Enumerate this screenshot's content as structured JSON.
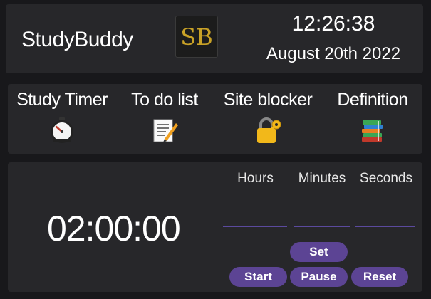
{
  "header": {
    "app_title": "StudyBuddy",
    "logo_text": "SB",
    "time": "12:26:38",
    "date": "August 20th 2022"
  },
  "nav": {
    "items": [
      {
        "label": "Study Timer",
        "icon": "stopwatch-icon"
      },
      {
        "label": "To do list",
        "icon": "memo-icon"
      },
      {
        "label": "Site blocker",
        "icon": "lock-with-key-icon"
      },
      {
        "label": "Definition",
        "icon": "books-icon"
      }
    ]
  },
  "timer": {
    "display": "02:00:00",
    "hours_label": "Hours",
    "minutes_label": "Minutes",
    "seconds_label": "Seconds",
    "hours_value": "",
    "minutes_value": "",
    "seconds_value": "",
    "set_label": "Set",
    "start_label": "Start",
    "pause_label": "Pause",
    "reset_label": "Reset"
  },
  "colors": {
    "background": "#18181b",
    "card": "#27272a",
    "accent": "#5c4494",
    "logo_gold": "#c9a227"
  }
}
